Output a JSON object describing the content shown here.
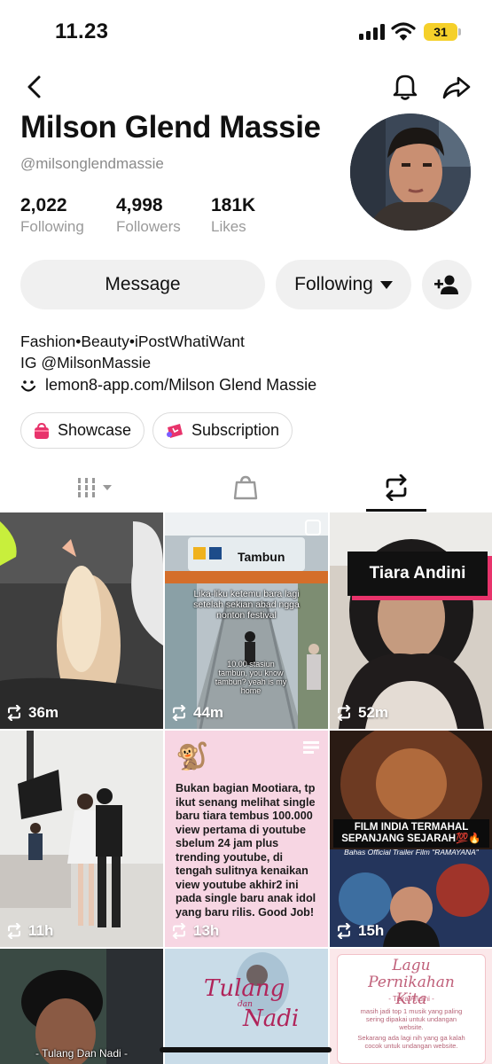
{
  "status_bar": {
    "time": "11.23",
    "battery": "31"
  },
  "profile": {
    "name": "Milson Glend Massie",
    "handle": "@milsonglendmassie",
    "stats": [
      {
        "value": "2,022",
        "label": "Following"
      },
      {
        "value": "4,998",
        "label": "Followers"
      },
      {
        "value": "181K",
        "label": "Likes"
      }
    ],
    "bio_line1": "Fashion•Beauty•iPostWhatiWant",
    "bio_line2": "IG @MilsonMassie",
    "link": "lemon8-app.com/Milson Glend Massie"
  },
  "actions": {
    "message": "Message",
    "following": "Following"
  },
  "chips": [
    {
      "label": "Showcase",
      "icon": "shopping-bag-icon"
    },
    {
      "label": "Subscription",
      "icon": "subscription-icon"
    }
  ],
  "tabs": [
    "videos-grid-icon",
    "shop-bag-icon",
    "repost-icon"
  ],
  "grid": [
    {
      "count": "36m"
    },
    {
      "count": "44m",
      "station": "Tambun",
      "caption": "Lika-liku ketemu bara lagi setelah sekian abad ngga nonton festival",
      "caption2": "10.00 stasiun tambun, you know tambun? yeah is my home"
    },
    {
      "count": "52m",
      "banner": "Tiara Andini"
    },
    {
      "count": "11h"
    },
    {
      "count": "13h",
      "text": "Bukan bagian Mootiara, tp ikut senang melihat single baru tiara tembus 100.000 view pertama di youtube sbelum 24 jam plus trending youtube, di tengah sulitnya kenaikan view youtube akhir2 ini pada single baru anak idol yang baru rilis. Good Job!"
    },
    {
      "count": "15h",
      "headline": "FILM INDIA TERMAHAL SEPANJANG SEJARAH💯🔥",
      "sub": "Bahas Official Trailer Film \"RAMAYANA\""
    },
    {
      "caption": "- Tulang Dan Nadi -"
    },
    {
      "title1": "Tulang",
      "title2": "Nadi",
      "title_small": "dan"
    },
    {
      "title": "Lagu Pernikahan Kita",
      "artist": "- Tiara Andini -",
      "body": "masih jadi top 1 musik yang paling sering dipakai untuk undangan website.",
      "body2": "Sekarang ada lagi nih yang ga kalah cocok untuk undangan website."
    }
  ],
  "colors": {
    "accent_pink": "#e8336b",
    "chip_bg": "#f0f0f0",
    "battery": "#f5d02a"
  }
}
